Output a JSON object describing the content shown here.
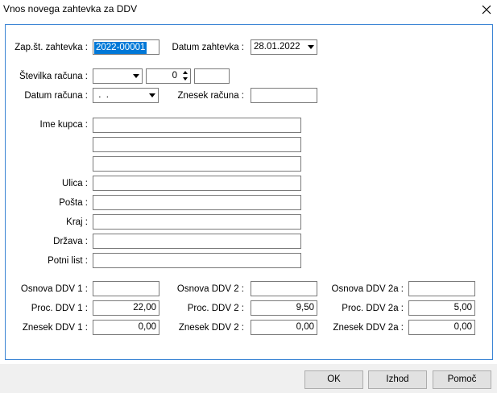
{
  "window": {
    "title": "Vnos novega zahtevka za DDV"
  },
  "header": {
    "zap_label": "Zap.št. zahtevka :",
    "zap_value": "2022-00001",
    "datum_zahtevka_label": "Datum zahtevka :",
    "datum_zahtevka_value": "28.01.2022",
    "stevilka_label": "Številka računa :",
    "stevilka_combo_value": "",
    "stevilka_spin_value": "0",
    "stevilka_extra_value": "",
    "datum_racuna_label": "Datum računa :",
    "datum_racuna_value": " .  .",
    "znesek_racuna_label": "Znesek računa :",
    "znesek_racuna_value": ""
  },
  "customer": {
    "ime_label": "Ime kupca :",
    "ime_1": "",
    "ime_2": "",
    "ime_3": "",
    "ulica_label": "Ulica :",
    "ulica_value": "",
    "posta_label": "Pošta :",
    "posta_value": "",
    "kraj_label": "Kraj :",
    "kraj_value": "",
    "drzava_label": "Država :",
    "drzava_value": "",
    "potni_label": "Potni list :",
    "potni_value": ""
  },
  "vat": {
    "col1": {
      "osnova_label": "Osnova DDV 1 :",
      "osnova_value": "",
      "proc_label": "Proc. DDV 1 :",
      "proc_value": "22,00",
      "znesek_label": "Znesek DDV 1 :",
      "znesek_value": "0,00"
    },
    "col2": {
      "osnova_label": "Osnova DDV 2 :",
      "osnova_value": "",
      "proc_label": "Proc. DDV 2 :",
      "proc_value": "9,50",
      "znesek_label": "Znesek DDV 2 :",
      "znesek_value": "0,00"
    },
    "col3": {
      "osnova_label": "Osnova DDV 2a :",
      "osnova_value": "",
      "proc_label": "Proc. DDV 2a :",
      "proc_value": "5,00",
      "znesek_label": "Znesek DDV 2a :",
      "znesek_value": "0,00"
    }
  },
  "buttons": {
    "ok": "OK",
    "izhod": "Izhod",
    "pomoc": "Pomoč"
  },
  "colors": {
    "accent": "#0078d7",
    "panel_border": "#3b84d4",
    "footer_bg": "#f0f0f0"
  }
}
